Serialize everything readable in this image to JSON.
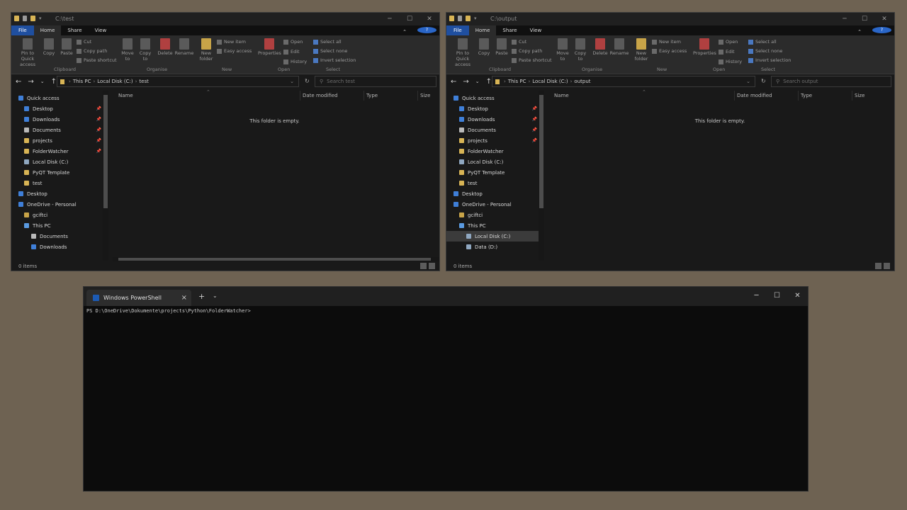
{
  "windows": [
    {
      "title": "C:\\test",
      "tabs": [
        "File",
        "Home",
        "Share",
        "View"
      ],
      "ribbon": {
        "pin": "Pin to Quick access",
        "copy": "Copy",
        "paste": "Paste",
        "cut": "Cut",
        "copy_path": "Copy path",
        "paste_shortcut": "Paste shortcut",
        "move_to": "Move to",
        "copy_to": "Copy to",
        "delete": "Delete",
        "rename": "Rename",
        "new_folder": "New folder",
        "new_item": "New item",
        "easy_access": "Easy access",
        "properties": "Properties",
        "open": "Open",
        "edit": "Edit",
        "history": "History",
        "select_all": "Select all",
        "select_none": "Select none",
        "invert_selection": "Invert selection",
        "groups": [
          "Clipboard",
          "Organise",
          "New",
          "Open",
          "Select"
        ]
      },
      "address": {
        "parts": [
          "This PC",
          "Local Disk (C:)",
          "test"
        ],
        "search_placeholder": "Search test"
      },
      "nav_items": [
        {
          "label": "Quick access",
          "icon": "star-icon",
          "pinned": false
        },
        {
          "label": "Desktop",
          "icon": "desktop-icon",
          "pinned": true
        },
        {
          "label": "Downloads",
          "icon": "download-icon",
          "pinned": true
        },
        {
          "label": "Documents",
          "icon": "document-icon",
          "pinned": true
        },
        {
          "label": "projects",
          "icon": "folder-icon",
          "pinned": true
        },
        {
          "label": "FolderWatcher",
          "icon": "folder-icon",
          "pinned": true
        },
        {
          "label": "Local Disk (C:)",
          "icon": "drive-icon",
          "pinned": false
        },
        {
          "label": "PyQT Template",
          "icon": "folder-icon",
          "pinned": false
        },
        {
          "label": "test",
          "icon": "folder-icon",
          "pinned": false
        },
        {
          "label": "Desktop",
          "icon": "desktop-icon",
          "pinned": false
        },
        {
          "label": "OneDrive - Personal",
          "icon": "cloud-icon",
          "pinned": false
        },
        {
          "label": "gciftci",
          "icon": "user-folder-icon",
          "pinned": false
        },
        {
          "label": "This PC",
          "icon": "computer-icon",
          "pinned": false
        },
        {
          "label": "Documents",
          "icon": "document-icon",
          "pinned": false
        },
        {
          "label": "Downloads",
          "icon": "download-icon",
          "pinned": false
        }
      ],
      "columns": [
        "Name",
        "Date modified",
        "Type",
        "Size"
      ],
      "empty_message": "This folder is empty.",
      "status": "0 items"
    },
    {
      "title": "C:\\output",
      "tabs": [
        "File",
        "Home",
        "Share",
        "View"
      ],
      "ribbon": {
        "pin": "Pin to Quick access",
        "copy": "Copy",
        "paste": "Paste",
        "cut": "Cut",
        "copy_path": "Copy path",
        "paste_shortcut": "Paste shortcut",
        "move_to": "Move to",
        "copy_to": "Copy to",
        "delete": "Delete",
        "rename": "Rename",
        "new_folder": "New folder",
        "new_item": "New item",
        "easy_access": "Easy access",
        "properties": "Properties",
        "open": "Open",
        "edit": "Edit",
        "history": "History",
        "select_all": "Select all",
        "select_none": "Select none",
        "invert_selection": "Invert selection",
        "groups": [
          "Clipboard",
          "Organise",
          "New",
          "Open",
          "Select"
        ]
      },
      "address": {
        "parts": [
          "This PC",
          "Local Disk (C:)",
          "output"
        ],
        "search_placeholder": "Search output"
      },
      "nav_items": [
        {
          "label": "Quick access",
          "icon": "star-icon",
          "pinned": false
        },
        {
          "label": "Desktop",
          "icon": "desktop-icon",
          "pinned": true
        },
        {
          "label": "Downloads",
          "icon": "download-icon",
          "pinned": true
        },
        {
          "label": "Documents",
          "icon": "document-icon",
          "pinned": true
        },
        {
          "label": "projects",
          "icon": "folder-icon",
          "pinned": true
        },
        {
          "label": "FolderWatcher",
          "icon": "folder-icon",
          "pinned": false
        },
        {
          "label": "Local Disk (C:)",
          "icon": "drive-icon",
          "pinned": false
        },
        {
          "label": "PyQT Template",
          "icon": "folder-icon",
          "pinned": false
        },
        {
          "label": "test",
          "icon": "folder-icon",
          "pinned": false
        },
        {
          "label": "Desktop",
          "icon": "desktop-icon",
          "pinned": false
        },
        {
          "label": "OneDrive - Personal",
          "icon": "cloud-icon",
          "pinned": false
        },
        {
          "label": "gciftci",
          "icon": "user-folder-icon",
          "pinned": false
        },
        {
          "label": "This PC",
          "icon": "computer-icon",
          "pinned": false
        },
        {
          "label": "Local Disk (C:)",
          "icon": "drive-icon",
          "pinned": false,
          "selected": true
        },
        {
          "label": "Data (D:)",
          "icon": "drive-icon",
          "pinned": false
        }
      ],
      "columns": [
        "Name",
        "Date modified",
        "Type",
        "Size"
      ],
      "empty_message": "This folder is empty.",
      "status": "0 items"
    }
  ],
  "terminal": {
    "tab_title": "Windows PowerShell",
    "prompt": "PS D:\\OneDrive\\Dokumente\\projects\\Python\\FolderWatcher>"
  },
  "colors": {
    "desktop": "#6e6252",
    "file_tab": "#1f4fa0",
    "folder": "#d8b455",
    "accent": "#2a66c8"
  }
}
